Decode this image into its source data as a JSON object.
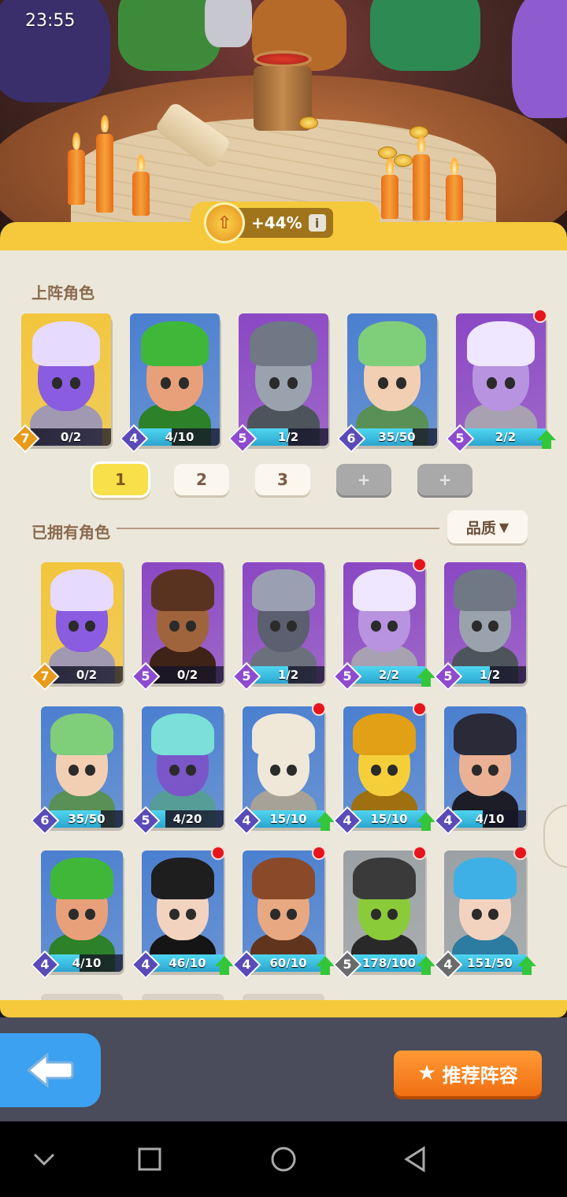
{
  "status_bar": {
    "time": "23:55"
  },
  "bonus": {
    "value": "+44%",
    "info_label": "i"
  },
  "lineup": {
    "title": "上阵角色",
    "cards": [
      {
        "name": "purple-star-demon",
        "level": "7",
        "count": "0/2",
        "progress": 0,
        "rarity_color": "#e89a1a",
        "bg": "#f2c53a",
        "skin": "#8a5ce0",
        "hair": "#e6dbff",
        "red_dot": false,
        "upgrade": false
      },
      {
        "name": "green-hair-warrior",
        "level": "4",
        "count": "4/10",
        "progress": 0.4,
        "rarity_color": "#5a4bb8",
        "bg": "#4a7fd0",
        "skin": "#e8a07a",
        "hair": "#3fb83a",
        "red_dot": false,
        "upgrade": false
      },
      {
        "name": "armored-knight",
        "level": "5",
        "count": "1/2",
        "progress": 0.5,
        "rarity_color": "#8e4bd0",
        "bg": "#8a47c4",
        "skin": "#9aa2ad",
        "hair": "#6f7884",
        "red_dot": false,
        "upgrade": false
      },
      {
        "name": "green-fairy",
        "level": "6",
        "count": "35/50",
        "progress": 0.7,
        "rarity_color": "#5a4bb8",
        "bg": "#4a7fd0",
        "skin": "#f2cfb3",
        "hair": "#7fce7a",
        "red_dot": false,
        "upgrade": false
      },
      {
        "name": "purple-horned-ninja",
        "level": "5",
        "count": "2/2",
        "progress": 1,
        "rarity_color": "#8e4bd0",
        "bg": "#8a47c4",
        "skin": "#b793e0",
        "hair": "#efe6ff",
        "red_dot": true,
        "upgrade": true
      }
    ]
  },
  "team_tabs": [
    {
      "label": "1",
      "state": "active"
    },
    {
      "label": "2",
      "state": "normal"
    },
    {
      "label": "3",
      "state": "normal"
    },
    {
      "label": "+",
      "state": "locked"
    },
    {
      "label": "+",
      "state": "locked"
    }
  ],
  "owned": {
    "title": "已拥有角色",
    "sort_label": "品质",
    "sort_arrow": "▼",
    "cards": [
      {
        "name": "purple-star-demon",
        "level": "7",
        "count": "0/2",
        "progress": 0,
        "rarity_color": "#e89a1a",
        "bg": "#f2c53a",
        "skin": "#8a5ce0",
        "hair": "#e6dbff",
        "red_dot": false,
        "upgrade": false
      },
      {
        "name": "minotaur",
        "level": "5",
        "count": "0/2",
        "progress": 0,
        "rarity_color": "#8e4bd0",
        "bg": "#8a47c4",
        "skin": "#a0643c",
        "hair": "#5a3220",
        "red_dot": false,
        "upgrade": false
      },
      {
        "name": "dark-hooded-knight",
        "level": "5",
        "count": "1/2",
        "progress": 0.5,
        "rarity_color": "#8e4bd0",
        "bg": "#8a47c4",
        "skin": "#5b5f70",
        "hair": "#9aa0b2",
        "red_dot": false,
        "upgrade": false
      },
      {
        "name": "purple-horned-ninja",
        "level": "5",
        "count": "2/2",
        "progress": 1,
        "rarity_color": "#8e4bd0",
        "bg": "#8a47c4",
        "skin": "#b793e0",
        "hair": "#efe6ff",
        "red_dot": true,
        "upgrade": true
      },
      {
        "name": "armored-knight",
        "level": "5",
        "count": "1/2",
        "progress": 0.5,
        "rarity_color": "#8e4bd0",
        "bg": "#8a47c4",
        "skin": "#9aa2ad",
        "hair": "#6f7884",
        "red_dot": false,
        "upgrade": false
      },
      {
        "name": "green-fairy",
        "level": "6",
        "count": "35/50",
        "progress": 0.7,
        "rarity_color": "#5a4bb8",
        "bg": "#4a7fd0",
        "skin": "#f2cfb3",
        "hair": "#7fce7a",
        "red_dot": false,
        "upgrade": false
      },
      {
        "name": "cyan-hair-demon",
        "level": "5",
        "count": "4/20",
        "progress": 0.2,
        "rarity_color": "#5a4bb8",
        "bg": "#4a7fd0",
        "skin": "#7a56c8",
        "hair": "#7be0d8",
        "red_dot": false,
        "upgrade": false
      },
      {
        "name": "skeleton-swordsman",
        "level": "4",
        "count": "15/10",
        "progress": 1,
        "rarity_color": "#5a4bb8",
        "bg": "#4a7fd0",
        "skin": "#efe7d8",
        "hair": "#efe7d8",
        "red_dot": true,
        "upgrade": true
      },
      {
        "name": "golden-mask-warrior",
        "level": "4",
        "count": "15/10",
        "progress": 1,
        "rarity_color": "#5a4bb8",
        "bg": "#4a7fd0",
        "skin": "#f5cf3a",
        "hair": "#e2a016",
        "red_dot": true,
        "upgrade": true
      },
      {
        "name": "crystal-shield-guard",
        "level": "4",
        "count": "4/10",
        "progress": 0.4,
        "rarity_color": "#5a4bb8",
        "bg": "#4a7fd0",
        "skin": "#eab194",
        "hair": "#2a2a38",
        "red_dot": false,
        "upgrade": false
      },
      {
        "name": "green-hair-warrior",
        "level": "4",
        "count": "4/10",
        "progress": 0.4,
        "rarity_color": "#5a4bb8",
        "bg": "#4a7fd0",
        "skin": "#e8a07a",
        "hair": "#3fb83a",
        "red_dot": false,
        "upgrade": false
      },
      {
        "name": "cheerleader",
        "level": "4",
        "count": "46/10",
        "progress": 1,
        "rarity_color": "#5a4bb8",
        "bg": "#4a7fd0",
        "skin": "#f2d3c0",
        "hair": "#1e1e1e",
        "red_dot": true,
        "upgrade": true
      },
      {
        "name": "shield-bearer",
        "level": "4",
        "count": "60/10",
        "progress": 1,
        "rarity_color": "#5a4bb8",
        "bg": "#4a7fd0",
        "skin": "#e8a882",
        "hair": "#8a4a2a",
        "red_dot": true,
        "upgrade": true
      },
      {
        "name": "goblin",
        "level": "5",
        "count": "178/100",
        "progress": 1,
        "rarity_color": "#6b6b6b",
        "bg": "#9aa0a4",
        "skin": "#8acb3a",
        "hair": "#3a3a3a",
        "red_dot": true,
        "upgrade": true
      },
      {
        "name": "blue-hair-girl",
        "level": "4",
        "count": "151/50",
        "progress": 1,
        "rarity_color": "#6b6b6b",
        "bg": "#9aa0a4",
        "skin": "#f2d3c0",
        "hair": "#3fb0e6",
        "red_dot": true,
        "upgrade": true
      }
    ]
  },
  "buttons": {
    "recommend_label": "推荐阵容",
    "back_icon": "back-arrow-icon"
  },
  "navbar": {
    "icons": [
      "chevron-down-icon",
      "recent-apps-icon",
      "home-icon",
      "back-triangle-icon"
    ]
  }
}
